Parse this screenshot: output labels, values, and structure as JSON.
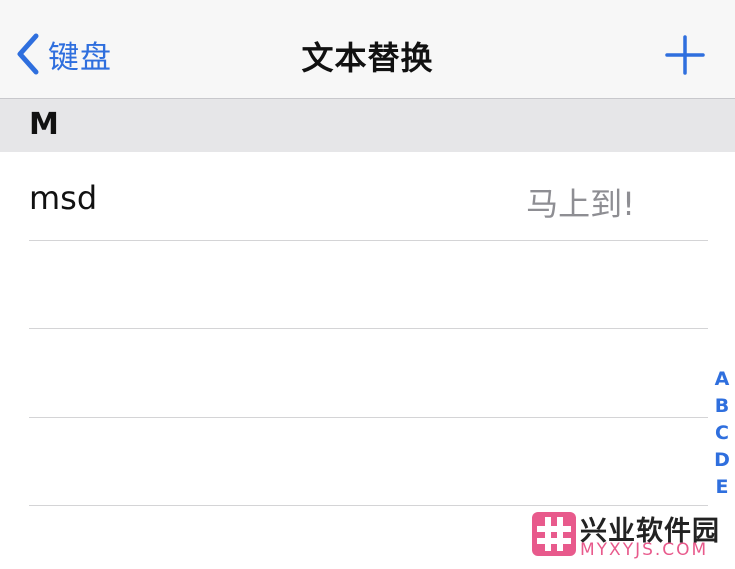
{
  "navbar": {
    "back_label": "键盘",
    "title": "文本替换"
  },
  "section": {
    "letter": "M"
  },
  "rows": [
    {
      "shortcut": "msd",
      "phrase": "马上到!"
    },
    {
      "shortcut": "",
      "phrase": ""
    },
    {
      "shortcut": "",
      "phrase": ""
    },
    {
      "shortcut": "",
      "phrase": ""
    }
  ],
  "index_letters": [
    "A",
    "B",
    "C",
    "D",
    "E"
  ],
  "watermark": {
    "name": "兴业软件园",
    "url": "MYXYJS.COM"
  },
  "colors": {
    "accent": "#2f6fde",
    "secondary_text": "#8e8e93",
    "section_bg": "#e6e6e8",
    "watermark_pink": "#e85a8c"
  }
}
